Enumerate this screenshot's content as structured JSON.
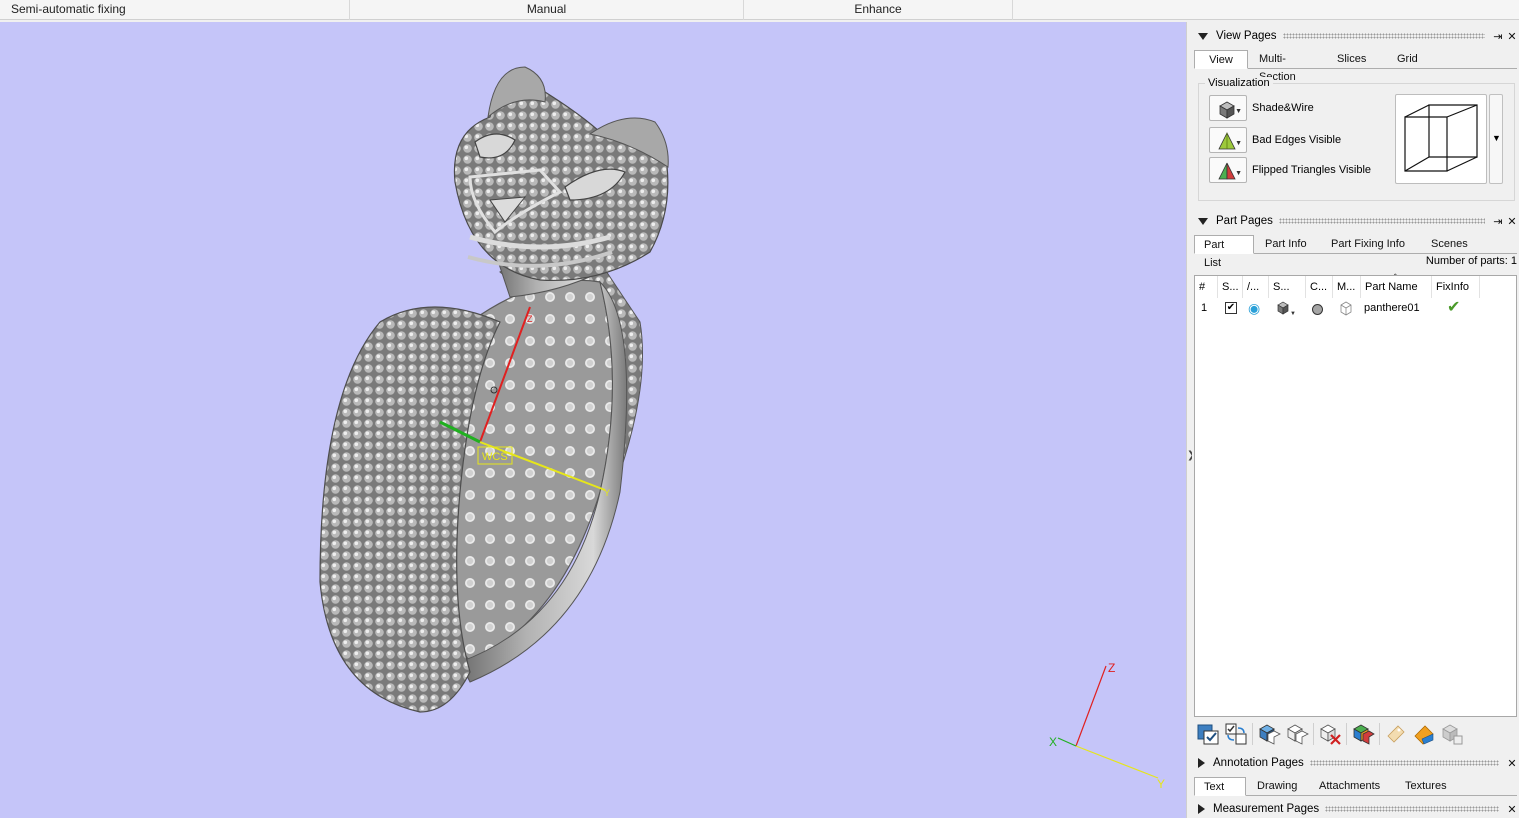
{
  "ribbon": {
    "groups": [
      "Semi-automatic fixing",
      "Manual",
      "Enhance"
    ]
  },
  "viewport": {
    "background": "#c5c5f9",
    "wcs_label": "WCS",
    "axis_labels": {
      "x": "X",
      "y": "Y",
      "z": "Z"
    },
    "model_color": "#8a8a8a"
  },
  "view_pages": {
    "title": "View Pages",
    "tabs": [
      "View",
      "Multi-Section",
      "Slices",
      "Grid"
    ],
    "active_tab": "View",
    "visualization": {
      "legend": "Visualization",
      "items": [
        {
          "label": "Shade&Wire",
          "icon": "shade-wire-icon"
        },
        {
          "label": "Bad Edges Visible",
          "icon": "bad-edges-icon"
        },
        {
          "label": "Flipped Triangles Visible",
          "icon": "flipped-triangles-icon"
        }
      ],
      "view_icon": "wireframe-cube-icon"
    }
  },
  "part_pages": {
    "title": "Part Pages",
    "tabs": [
      "Part List",
      "Part Info",
      "Part Fixing Info",
      "Scenes"
    ],
    "active_tab": "Part List",
    "number_of_parts_label": "Number of parts: 1",
    "columns": [
      "#",
      "S...",
      "/...",
      "S...",
      "C...",
      "M...",
      "Part Name",
      "FixInfo"
    ],
    "rows": [
      {
        "index": "1",
        "checked": true,
        "visible": true,
        "name": "panthere01",
        "fixed": true
      }
    ],
    "toolbar_icons": [
      "select-all-icon",
      "invert-selection-icon",
      "show-parts-icon",
      "hide-parts-icon",
      "remove-part-icon",
      "color-parts-icon",
      "export-icon",
      "tag-icon",
      "duplicate-icon"
    ]
  },
  "annotation_pages": {
    "title": "Annotation Pages",
    "tabs": [
      "Text",
      "Drawing",
      "Attachments",
      "Textures"
    ],
    "active_tab": "Text"
  },
  "measurement_pages": {
    "title": "Measurement Pages"
  },
  "colors": {
    "accent_green": "#4a9a2a",
    "axis_red": "#e02020",
    "axis_green": "#20b020",
    "axis_yellow": "#e6e61a"
  }
}
